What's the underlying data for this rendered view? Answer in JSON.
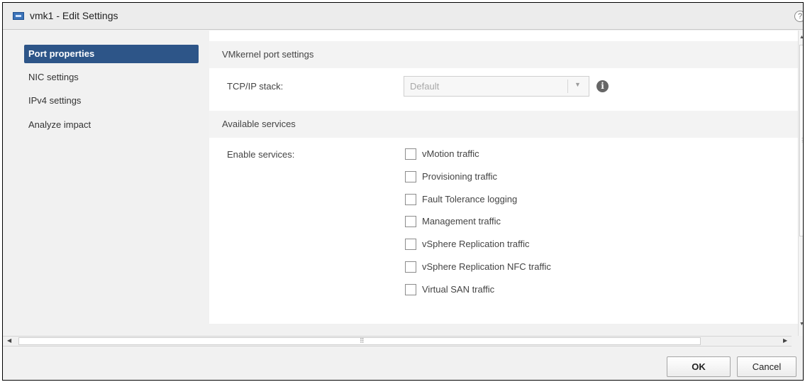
{
  "window": {
    "title": "vmk1 - Edit Settings",
    "help_icon": "help-icon",
    "help_glyph": "?"
  },
  "sidebar": {
    "items": [
      {
        "label": "Port properties",
        "active": true
      },
      {
        "label": "NIC settings",
        "active": false
      },
      {
        "label": "IPv4 settings",
        "active": false
      },
      {
        "label": "Analyze impact",
        "active": false
      }
    ]
  },
  "main": {
    "port_settings_header": "VMkernel port settings",
    "tcpip": {
      "label": "TCP/IP stack:",
      "value": "Default",
      "info_icon": "info-icon"
    },
    "services_header": "Available services",
    "enable_label": "Enable services:",
    "services": [
      {
        "label": "vMotion traffic",
        "checked": false
      },
      {
        "label": "Provisioning traffic",
        "checked": false
      },
      {
        "label": "Fault Tolerance logging",
        "checked": false
      },
      {
        "label": "Management traffic",
        "checked": false
      },
      {
        "label": "vSphere Replication traffic",
        "checked": false
      },
      {
        "label": "vSphere Replication NFC traffic",
        "checked": false
      },
      {
        "label": "Virtual SAN traffic",
        "checked": false
      }
    ]
  },
  "footer": {
    "ok_label": "OK",
    "cancel_label": "Cancel"
  },
  "colors": {
    "active_nav": "#2d5588",
    "titlebar": "#ececec",
    "panel": "#f1f1f1"
  }
}
